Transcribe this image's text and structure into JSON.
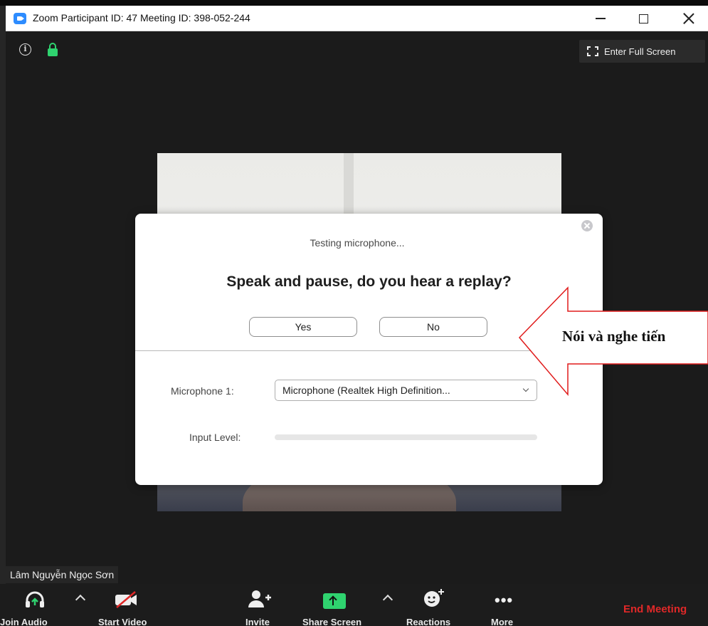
{
  "window": {
    "title": "Zoom Participant ID: 47   Meeting ID: 398-052-244"
  },
  "top_controls": {
    "fullscreen_label": "Enter Full Screen"
  },
  "dialog": {
    "status_text": "Testing microphone...",
    "question": "Speak and pause, do you hear a replay?",
    "yes_label": "Yes",
    "no_label": "No",
    "microphone_label": "Microphone 1:",
    "microphone_selected": "Microphone (Realtek High Definition...",
    "input_level_label": "Input Level:",
    "input_level": 0
  },
  "annotation": {
    "text": "Nói và nghe tiến",
    "arrow_color": "#e01b1b"
  },
  "participant": {
    "name": "Lâm Nguyễn Ngọc Sơn"
  },
  "toolbar": {
    "join_audio": "Join Audio",
    "start_video": "Start Video",
    "invite": "Invite",
    "share_screen": "Share Screen",
    "reactions": "Reactions",
    "more": "More",
    "end_meeting": "End Meeting"
  },
  "colors": {
    "accent_green": "#2fd36f",
    "end_red": "#e02828",
    "zoom_blue": "#2d8cff"
  }
}
